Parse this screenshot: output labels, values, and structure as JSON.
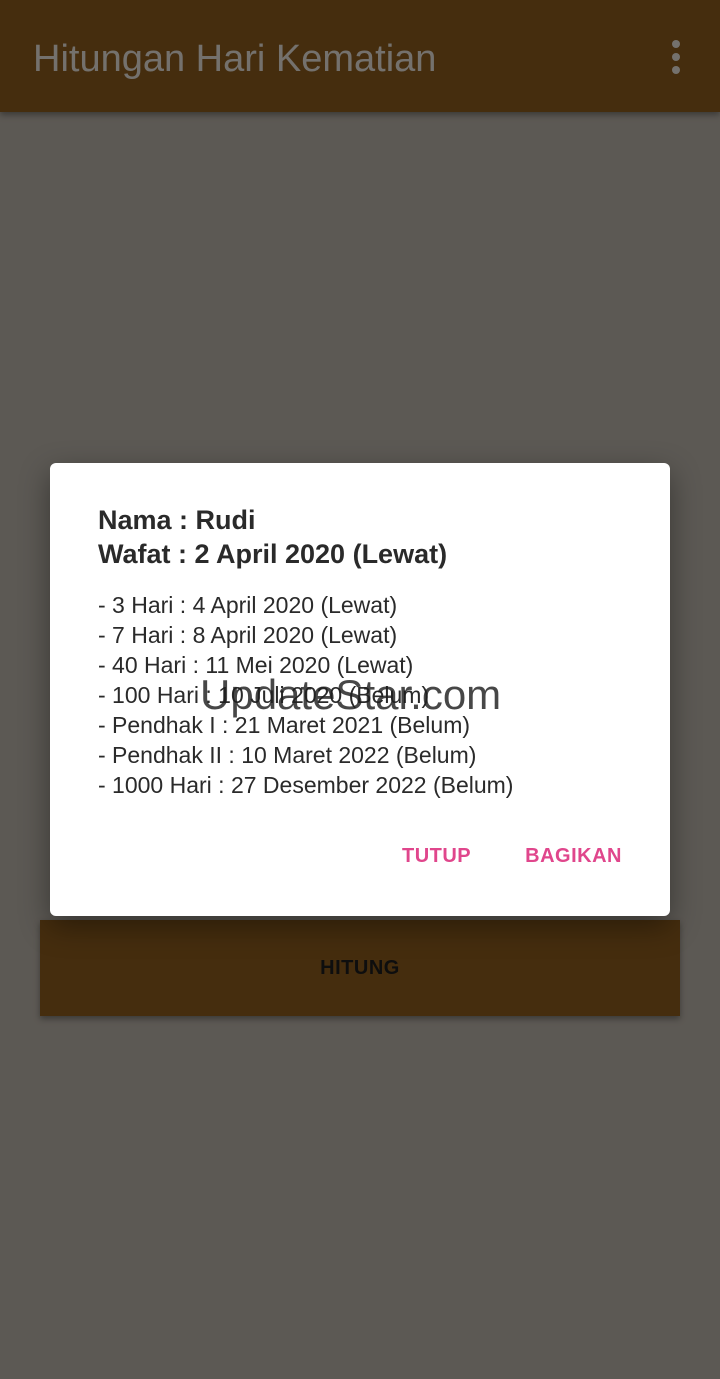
{
  "app_bar": {
    "title": "Hitungan Hari Kematian",
    "overflow_icon": "more-vert-icon"
  },
  "main": {
    "calculate_label": "HITUNG"
  },
  "dialog": {
    "name_line": "Nama : Rudi",
    "death_line": "Wafat :  2 April 2020 (Lewat)",
    "items": [
      "- 3 Hari :  4 April 2020 (Lewat)",
      "- 7 Hari :  8 April 2020 (Lewat)",
      "- 40 Hari :  11 Mei 2020 (Lewat)",
      "- 100 Hari :  10 Juli 2020 (Belum)",
      "- Pendhak I :  21 Maret 2021 (Belum)",
      "- Pendhak II :  10 Maret 2022 (Belum)",
      "- 1000 Hari :  27 Desember 2022 (Belum)"
    ],
    "close_label": "TUTUP",
    "share_label": "BAGIKAN"
  },
  "watermark": "UpdateStar.com",
  "colors": {
    "primary": "#8a5a1c",
    "accent": "#e0468c",
    "dialog_bg": "#ffffff"
  }
}
